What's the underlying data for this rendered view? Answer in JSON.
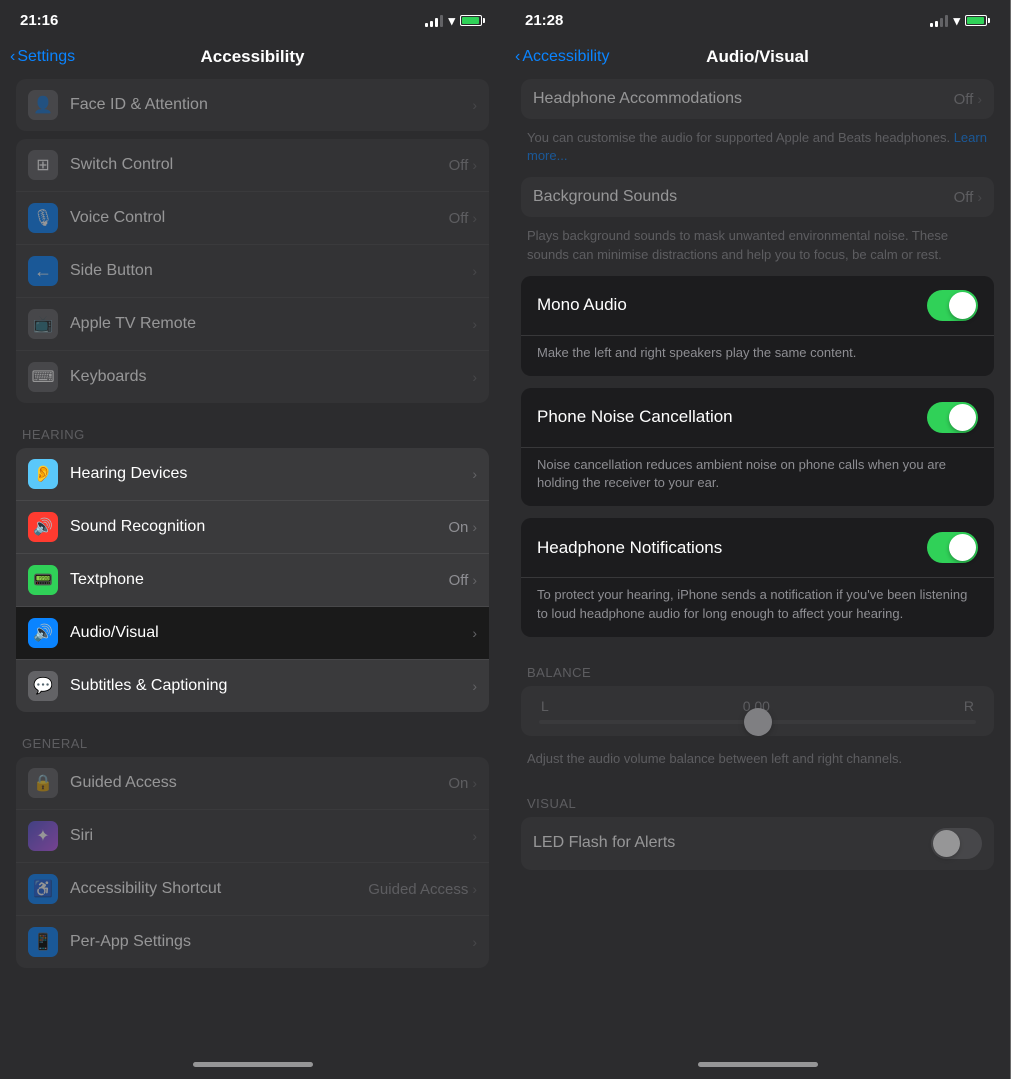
{
  "left": {
    "status": {
      "time": "21:16"
    },
    "nav": {
      "back": "Settings",
      "title": "Accessibility"
    },
    "partialRow": {
      "label": "Face ID & Attention"
    },
    "rows_top": [
      {
        "id": "switch-control",
        "icon": "⊞",
        "iconBg": "#636366",
        "label": "Switch Control",
        "value": "Off",
        "chevron": true
      },
      {
        "id": "voice-control",
        "icon": "🎙",
        "iconBg": "#0a84ff",
        "label": "Voice Control",
        "value": "Off",
        "chevron": true
      },
      {
        "id": "side-button",
        "icon": "▪",
        "iconBg": "#0a84ff",
        "label": "Side Button",
        "value": "",
        "chevron": true
      },
      {
        "id": "apple-tv-remote",
        "icon": "⊟",
        "iconBg": "#636366",
        "label": "Apple TV Remote",
        "value": "",
        "chevron": true
      },
      {
        "id": "keyboards",
        "icon": "⌨",
        "iconBg": "#636366",
        "label": "Keyboards",
        "value": "",
        "chevron": true
      }
    ],
    "hearing_header": "HEARING",
    "rows_hearing": [
      {
        "id": "hearing-devices",
        "icon": "👂",
        "iconBg": "#5ac8fa",
        "label": "Hearing Devices",
        "value": "",
        "chevron": true
      },
      {
        "id": "sound-recognition",
        "icon": "🔊",
        "iconBg": "#ff6b6b",
        "label": "Sound Recognition",
        "value": "On",
        "chevron": true
      },
      {
        "id": "textphone",
        "icon": "📟",
        "iconBg": "#30d158",
        "label": "Textphone",
        "value": "Off",
        "chevron": true
      },
      {
        "id": "audio-visual",
        "icon": "🔊",
        "iconBg": "#0a84ff",
        "label": "Audio/Visual",
        "value": "",
        "chevron": true,
        "selected": true
      },
      {
        "id": "subtitles-captioning",
        "icon": "💬",
        "iconBg": "#636366",
        "label": "Subtitles & Captioning",
        "value": "",
        "chevron": true
      }
    ],
    "general_header": "GENERAL",
    "rows_general": [
      {
        "id": "guided-access",
        "icon": "🔒",
        "iconBg": "#636366",
        "label": "Guided Access",
        "value": "On",
        "chevron": true
      },
      {
        "id": "siri",
        "icon": "🔮",
        "iconBg": "#5856d6",
        "label": "Siri",
        "value": "",
        "chevron": true
      },
      {
        "id": "accessibility-shortcut",
        "icon": "♿",
        "iconBg": "#0a84ff",
        "label": "Accessibility Shortcut",
        "value": "Guided Access",
        "chevron": true
      },
      {
        "id": "per-app-settings",
        "icon": "📱",
        "iconBg": "#0a84ff",
        "label": "Per-App Settings",
        "value": "",
        "chevron": true
      }
    ]
  },
  "right": {
    "status": {
      "time": "21:28"
    },
    "nav": {
      "back": "Accessibility",
      "title": "Audio/Visual"
    },
    "headphone_accommodations": {
      "label": "Headphone Accommodations",
      "value": "Off",
      "chevron": true
    },
    "headphone_desc": "You can customise the audio for supported Apple and Beats headphones.",
    "headphone_link": "Learn more...",
    "background_sounds": {
      "label": "Background Sounds",
      "value": "Off",
      "chevron": true
    },
    "background_desc": "Plays background sounds to mask unwanted environmental noise. These sounds can minimise distractions and help you to focus, be calm or rest.",
    "dark_cards": [
      {
        "id": "mono-audio",
        "label": "Mono Audio",
        "toggle": "on",
        "description": "Make the left and right speakers play the same content."
      },
      {
        "id": "phone-noise-cancellation",
        "label": "Phone Noise Cancellation",
        "toggle": "on",
        "description": "Noise cancellation reduces ambient noise on phone calls when you are holding the receiver to your ear."
      },
      {
        "id": "headphone-notifications",
        "label": "Headphone Notifications",
        "toggle": "on",
        "description": "To protect your hearing, iPhone sends a notification if you've been listening to loud headphone audio for long enough to affect your hearing."
      }
    ],
    "balance": {
      "header": "BALANCE",
      "left_label": "L",
      "right_label": "R",
      "value": "0.00",
      "description": "Adjust the audio volume balance between left and right channels."
    },
    "visual_header": "VISUAL",
    "led_flash": {
      "label": "LED Flash for Alerts",
      "toggle": "off"
    }
  }
}
